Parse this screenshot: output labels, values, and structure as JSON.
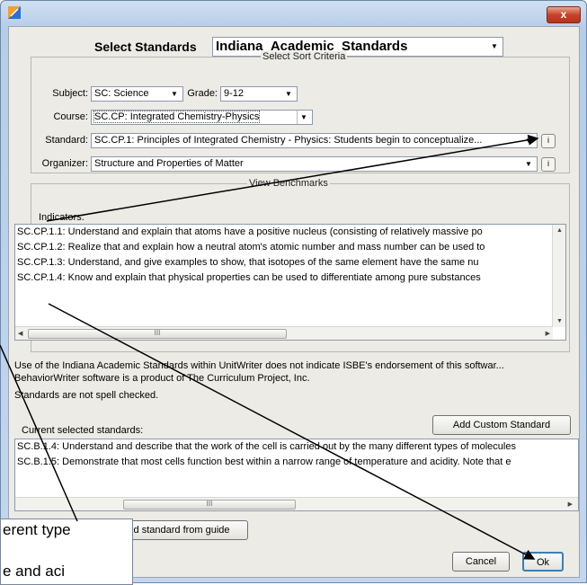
{
  "dialog": {
    "close_label": "x",
    "select_standards_label": "Select Standards",
    "standards_value": "Indiana_Academic_Standards"
  },
  "sort_criteria": {
    "title": "Select Sort Criteria",
    "subject_label": "Subject:",
    "subject_value": "SC: Science",
    "grade_label": "Grade:",
    "grade_value": "9-12",
    "course_label": "Course:",
    "course_value": "SC.CP: Integrated Chemistry-Physics",
    "standard_label": "Standard:",
    "standard_value": "SC.CP.1: Principles of Integrated Chemistry - Physics: Students begin to conceptualize...",
    "organizer_label": "Organizer:",
    "organizer_value": "Structure and Properties of Matter",
    "info_label": "i"
  },
  "benchmarks": {
    "title": "View Benchmarks",
    "indicators_label": "Indicators:",
    "rows": [
      "SC.CP.1.1: Understand and explain that atoms have a positive nucleus (consisting of relatively massive po",
      "SC.CP.1.2: Realize that and explain how a neutral atom's atomic number and mass number can be used to",
      "SC.CP.1.3: Understand, and give examples to show, that isotopes of the same element have the same nu",
      "SC.CP.1.4: Know and explain that physical properties can be used to differentiate among pure substances"
    ],
    "scroll_thumb": "III"
  },
  "notices": {
    "line1": "Use of the Indiana Academic Standards within UnitWriter does not indicate ISBE's endorsement of this softwar...",
    "line2": "BehaviorWriter software is a product of The Curriculum Project, Inc.",
    "line3": "Standards are not spell checked."
  },
  "current": {
    "label": "Current selected standards:",
    "add_custom_label": "Add Custom Standard",
    "rows": [
      "SC.B.1.4: Understand and describe that the work of the cell is carried out by the many different types of molecules",
      "SC.B.1.5: Demonstrate that most cells function best within a narrow range of temperature and acidity. Note that e"
    ],
    "scroll_thumb": "III",
    "remove_label": "ve selected standard from guide"
  },
  "buttons": {
    "cancel_label": "Cancel",
    "ok_label": "Ok"
  },
  "zoom_inset": {
    "line1": "erent type",
    "line2": "e and aci"
  },
  "colors": {
    "annotation_arrow": "#000000",
    "close_button": "#c7432a"
  }
}
